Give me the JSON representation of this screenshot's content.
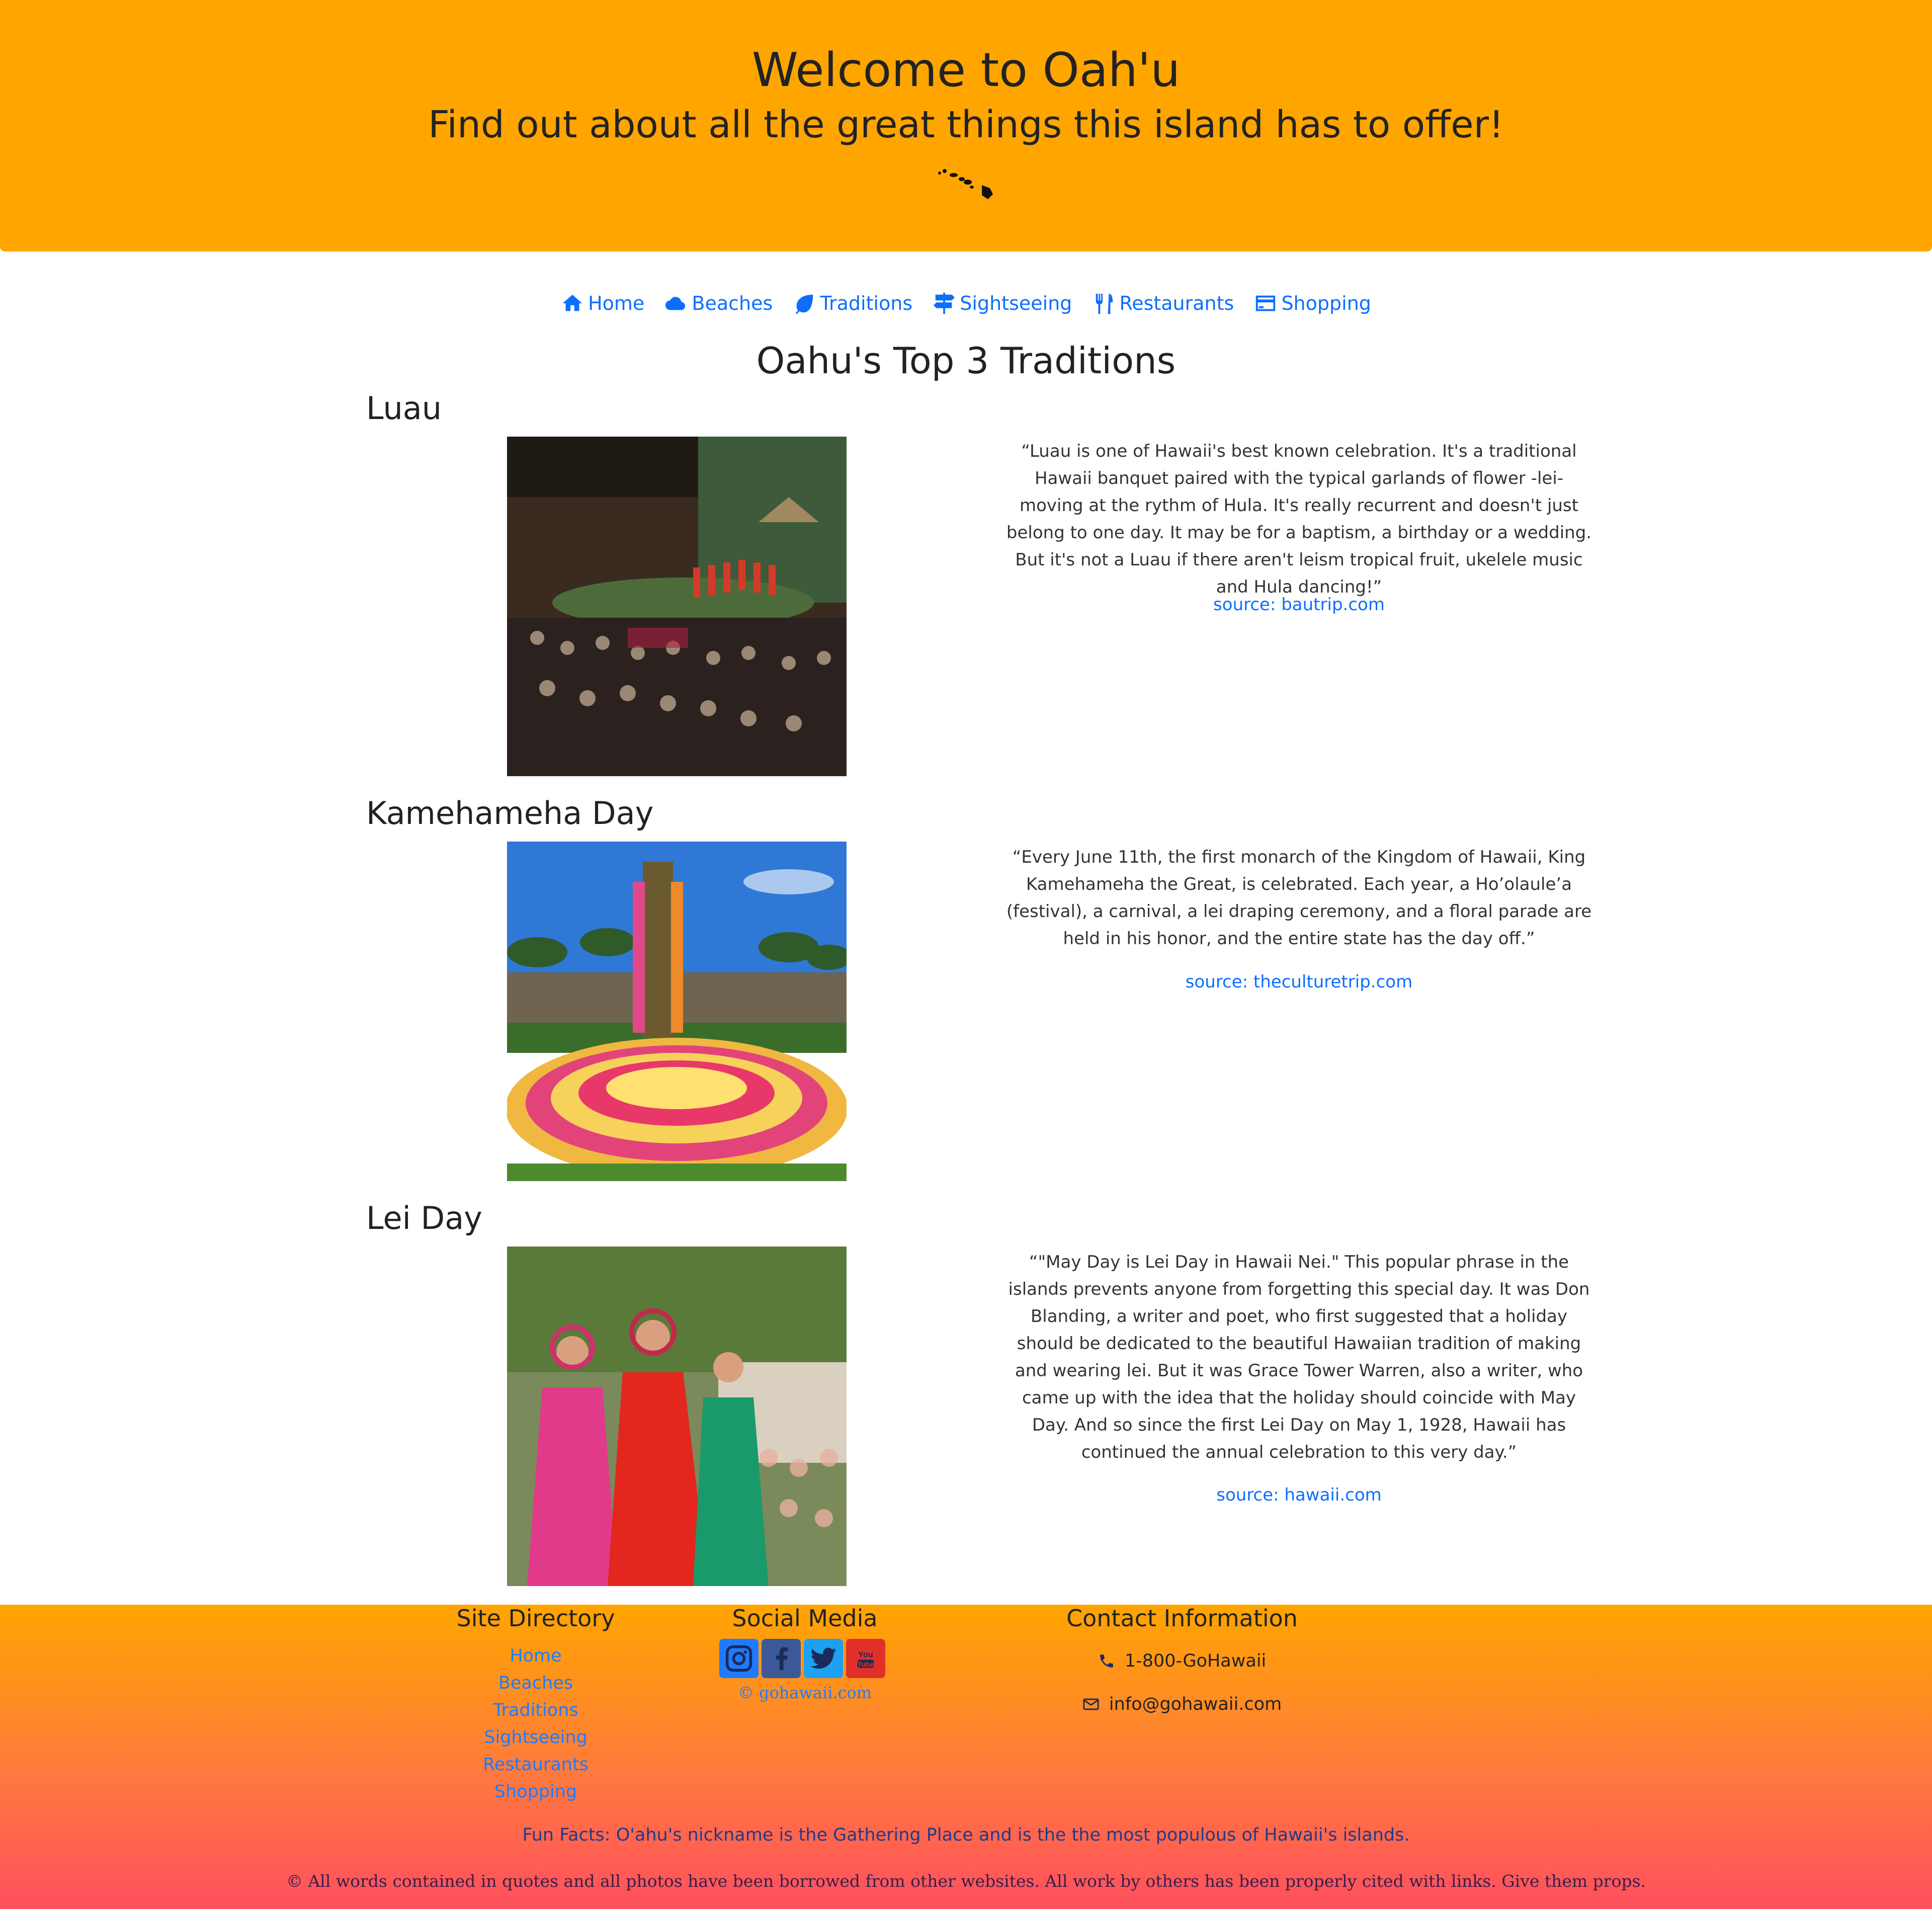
{
  "header": {
    "title": "Welcome to Oah'u",
    "subtitle": "Find out about all the great things this island has to offer!"
  },
  "nav": {
    "items": [
      {
        "label": "Home",
        "icon": "home-icon"
      },
      {
        "label": "Beaches",
        "icon": "cloud-icon"
      },
      {
        "label": "Traditions",
        "icon": "leaf-icon"
      },
      {
        "label": "Sightseeing",
        "icon": "signpost-icon"
      },
      {
        "label": "Restaurants",
        "icon": "utensils-icon"
      },
      {
        "label": "Shopping",
        "icon": "credit-card-icon"
      }
    ]
  },
  "main": {
    "title": "Oahu's Top 3 Traditions",
    "sections": [
      {
        "heading": "Luau",
        "quote": "“Luau is one of Hawaii's best known celebration. It's a traditional Hawaii banquet paired with the typical garlands of flower -lei- moving at the rythm of Hula. It's really recurrent and doesn't just belong to one day. It may be for a baptism, a birthday or a wedding. But it's not a Luau if there aren't leism tropical fruit, ukelele music and Hula dancing!”",
        "source": "source: bautrip.com"
      },
      {
        "heading": "Kamehameha Day",
        "quote": "“Every June 11th, the first monarch of the Kingdom of Hawaii, King Kamehameha the Great, is celebrated. Each year, a Ho’olaule’a (festival), a carnival, a lei draping ceremony, and a floral parade are held in his honor, and the entire state has the day off.”",
        "source": "source: theculturetrip.com"
      },
      {
        "heading": "Lei Day",
        "quote": "“\"May Day is Lei Day in Hawaii Nei.\" This popular phrase in the islands prevents anyone from forgetting this special day. It was Don Blanding, a writer and poet, who first suggested that a holiday should be dedicated to the beautiful Hawaiian tradition of making and wearing lei. But it was Grace Tower Warren, also a writer, who came up with the idea that the holiday should coincide with May Day. And so since the first Lei Day on May 1, 1928, Hawaii has continued the annual celebration to this very day.”",
        "source": "source: hawaii.com"
      }
    ]
  },
  "footer": {
    "directory_title": "Site Directory",
    "directory": [
      "Home",
      "Beaches",
      "Traditions",
      "Sightseeing",
      "Restaurants",
      "Shopping"
    ],
    "social_title": "Social Media",
    "social_icons": [
      "instagram-icon",
      "facebook-icon",
      "twitter-icon",
      "youtube-icon"
    ],
    "social_copyright": "© gohawaii.com",
    "contact_title": "Contact Information",
    "phone": "1-800-GoHawaii",
    "email": "info@gohawaii.com",
    "fun_facts": "Fun Facts: O'ahu's nickname is the Gathering Place and is the the most populous of Hawaii's islands.",
    "credits": "© All words contained in quotes and all photos have been borrowed from other websites. All work by others has been properly cited with links. Give them props."
  },
  "colors": {
    "header_bg": "#ffa500",
    "link": "#0d6efd",
    "footer_top": "#ffa500",
    "footer_bottom": "#ff4f5e"
  }
}
